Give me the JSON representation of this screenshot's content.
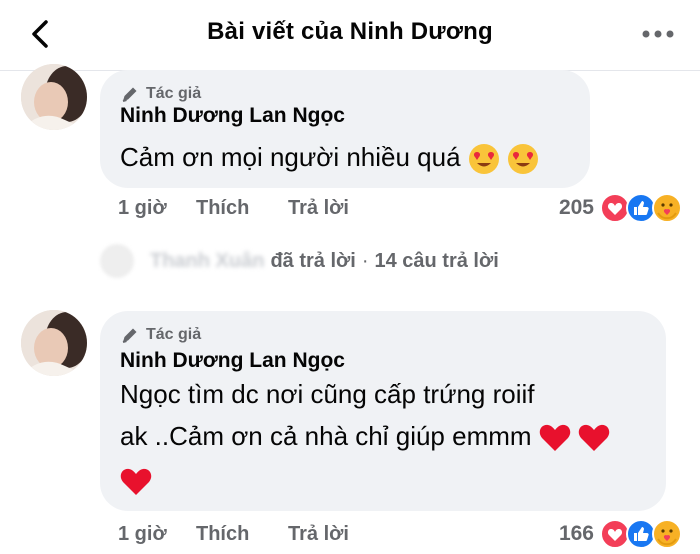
{
  "header": {
    "title": "Bài viết của Ninh Dương",
    "back_icon": "chevron-left-icon",
    "more_icon": "more-horizontal-icon"
  },
  "comments": [
    {
      "badge": "Tác giả",
      "author": "Ninh Dương Lan Ngọc",
      "text_lines": [
        "Cảm ơn mọi người  nhiều quá"
      ],
      "time": "1 giờ",
      "like_label": "Thích",
      "reply_label": "Trả lời",
      "reaction_count": "205",
      "reactions": [
        "love",
        "like",
        "care"
      ]
    },
    {
      "badge": "Tác giả",
      "author": "Ninh Dương Lan Ngọc",
      "text_lines": [
        "Ngọc tìm dc nơi cũng cấp trứng roiif",
        "ak ..Cảm ơn cả nhà chỉ giúp emmm"
      ],
      "time": "1 giờ",
      "like_label": "Thích",
      "reply_label": "Trả lời",
      "reaction_count": "166",
      "reactions": [
        "love",
        "like",
        "care"
      ]
    }
  ],
  "thread": {
    "replier_name": "Thanh Xuân",
    "replied_label": "đã trả lời",
    "separator": "·",
    "reply_count_label": "14 câu trả lời"
  },
  "colors": {
    "bubble": "#f0f2f5",
    "muted": "#65676b",
    "like_blue": "#1877f2",
    "love_red": "#f33e58",
    "care_yellow": "#f7b125"
  }
}
